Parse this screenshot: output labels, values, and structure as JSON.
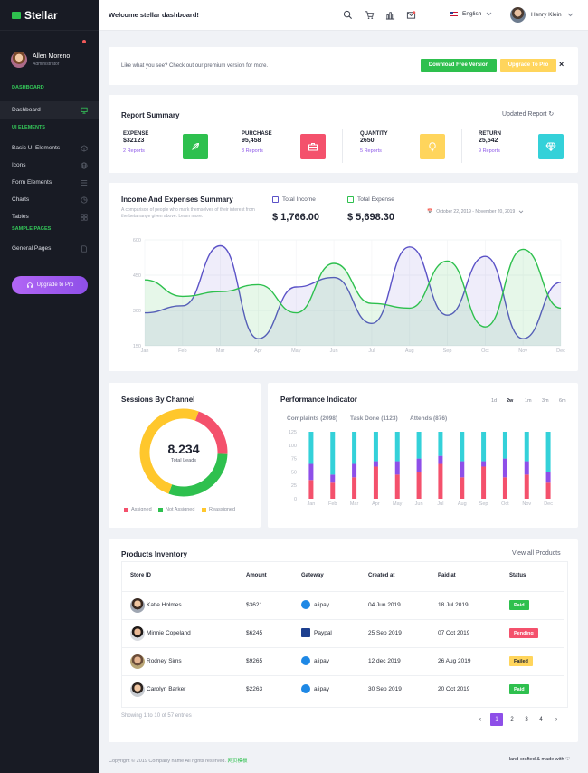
{
  "brand": "Stellar",
  "sidebar": {
    "profile": {
      "name": "Allen Moreno",
      "role": "Administrator"
    },
    "sections": {
      "dashboard": "DASHBOARD",
      "ui": "UI ELEMENTS",
      "sample": "SAMPLE PAGES"
    },
    "items": [
      {
        "label": "Dashboard",
        "icon": "monitor-icon"
      },
      {
        "label": "Basic UI Elements",
        "icon": "cube-icon"
      },
      {
        "label": "Icons",
        "icon": "globe-icon"
      },
      {
        "label": "Form Elements",
        "icon": "list-icon"
      },
      {
        "label": "Charts",
        "icon": "pie-chart-icon"
      },
      {
        "label": "Tables",
        "icon": "grid-icon"
      },
      {
        "label": "General Pages",
        "icon": "file-icon"
      }
    ],
    "upgrade": "Upgrade to Pro"
  },
  "topbar": {
    "title": "Welcome stellar dashboard!",
    "language": "English",
    "user": "Henry Klein"
  },
  "banner": {
    "text": "Like what you see? Check out our premium version for more.",
    "download": "Download Free Version",
    "upgrade": "Upgrade To Pro",
    "close": "×"
  },
  "report": {
    "title": "Report Summary",
    "updated": "Updated Report",
    "items": [
      {
        "label": "EXPENSE",
        "value": "$32123",
        "reports": "2 Reports",
        "color": "#2ec04e",
        "icon": "rocket-icon"
      },
      {
        "label": "PURCHASE",
        "value": "95,458",
        "reports": "3 Reports",
        "color": "#f4516c",
        "icon": "briefcase-icon"
      },
      {
        "label": "QUANTITY",
        "value": "2650",
        "reports": "5 Reports",
        "color": "#ffd55c",
        "icon": "bulb-icon"
      },
      {
        "label": "RETURN",
        "value": "25,542",
        "reports": "9 Reports",
        "color": "#34d1d9",
        "icon": "diamond-icon"
      }
    ]
  },
  "income": {
    "title": "Income And Expenses Summary",
    "desc": "A comparison of people who mark themselves of their interest from the beta range given above. Learn more.",
    "income_label": "Total Income",
    "income_value": "$ 1,766.00",
    "expense_label": "Total Expense",
    "expense_value": "$ 5,698.30",
    "date_range": "October 22, 2019 - November 20, 2019"
  },
  "sessions": {
    "title": "Sessions By Channel",
    "value": "8.234",
    "sub": "Total Leads",
    "legend": [
      "Assigned",
      "Not Assigned",
      "Reassigned"
    ]
  },
  "performance": {
    "title": "Performance Indicator",
    "tabs": [
      "Complaints (2098)",
      "Task Done (1123)",
      "Attends (876)"
    ],
    "periods": [
      "1d",
      "2w",
      "1m",
      "3m",
      "6m"
    ]
  },
  "products": {
    "title": "Products Inventory",
    "view_all": "View all Products",
    "headers": [
      "Store ID",
      "Amount",
      "Gateway",
      "Created at",
      "Paid at",
      "Status"
    ],
    "rows": [
      {
        "name": "Katie Holmes",
        "amount": "$3621",
        "gateway": "alipay",
        "created": "04 Jun 2019",
        "paid": "18 Jul 2019",
        "status": "Paid",
        "status_color": "#2ec04e"
      },
      {
        "name": "Minnie Copeland",
        "amount": "$6245",
        "gateway": "Paypal",
        "created": "25 Sep 2019",
        "paid": "07 Oct 2019",
        "status": "Pending",
        "status_color": "#f4516c"
      },
      {
        "name": "Rodney Sims",
        "amount": "$9265",
        "gateway": "alipay",
        "created": "12 dec 2019",
        "paid": "26 Aug 2019",
        "status": "Failed",
        "status_color": "#ffd55c"
      },
      {
        "name": "Carolyn Barker",
        "amount": "$2263",
        "gateway": "alipay",
        "created": "30 Sep 2019",
        "paid": "20 Oct 2019",
        "status": "Paid",
        "status_color": "#2ec04e"
      }
    ],
    "showing": "Showing 1 to 10 of 57 entries",
    "pages": [
      "‹",
      "1",
      "2",
      "3",
      "4",
      "›"
    ]
  },
  "footer": {
    "left": "Copyright © 2019 Company name All rights reserved.",
    "left_link": "网页模板",
    "right": "Hand-crafted & made with ♡"
  },
  "chart_data": [
    {
      "type": "area",
      "x": [
        "Jan",
        "Feb",
        "Mar",
        "Apr",
        "May",
        "Jun",
        "Jul",
        "Aug",
        "Sep",
        "Oct",
        "Nov",
        "Dec"
      ],
      "yticks": [
        150,
        300,
        450,
        600
      ],
      "ylim": [
        150,
        600
      ],
      "series": [
        {
          "name": "Total Income",
          "color": "#5b52c7",
          "fill": "rgba(120,110,210,0.12)",
          "values": [
            290,
            320,
            575,
            180,
            400,
            440,
            245,
            570,
            280,
            530,
            180,
            420
          ]
        },
        {
          "name": "Total Expense",
          "color": "#2ec04e",
          "fill": "rgba(46,192,78,0.12)",
          "values": [
            430,
            360,
            380,
            410,
            290,
            500,
            330,
            310,
            510,
            230,
            560,
            310
          ]
        }
      ]
    },
    {
      "type": "donut",
      "labels": [
        "Assigned",
        "Not Assigned",
        "Reassigned"
      ],
      "values": [
        20,
        30,
        50
      ],
      "colors": [
        "#f4516c",
        "#2ec04e",
        "#ffc72c"
      ]
    },
    {
      "type": "stacked-bar",
      "categories": [
        "Jan",
        "Feb",
        "Mar",
        "Apr",
        "May",
        "Jun",
        "Jul",
        "Aug",
        "Sep",
        "Oct",
        "Nov",
        "Dec"
      ],
      "yticks": [
        0,
        25,
        50,
        75,
        100,
        125
      ],
      "ylim": [
        0,
        125
      ],
      "series": [
        {
          "name": "Complaints",
          "color": "#f4516c",
          "values": [
            35,
            30,
            40,
            60,
            45,
            50,
            65,
            40,
            60,
            40,
            45,
            30
          ]
        },
        {
          "name": "Task Done",
          "color": "#8e4fe8",
          "values": [
            30,
            15,
            25,
            10,
            25,
            25,
            15,
            30,
            10,
            35,
            25,
            20
          ]
        },
        {
          "name": "Attends",
          "color": "#34d1d9",
          "values": [
            60,
            80,
            60,
            55,
            55,
            50,
            45,
            55,
            55,
            50,
            55,
            75
          ]
        }
      ]
    }
  ]
}
